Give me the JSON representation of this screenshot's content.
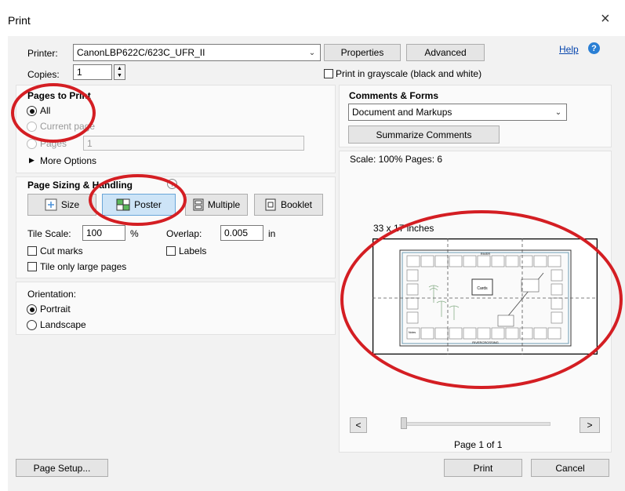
{
  "window": {
    "title": "Print",
    "close_glyph": "×"
  },
  "printer": {
    "label": "Printer:",
    "value": "CanonLBP622C/623C_UFR_II",
    "properties_label": "Properties",
    "advanced_label": "Advanced",
    "help_label": "Help"
  },
  "copies": {
    "label": "Copies:",
    "value": "1"
  },
  "grayscale": {
    "label": "Print in grayscale (black and white)",
    "checked": false
  },
  "pages_to_print": {
    "heading": "Pages to Print",
    "all_label": "All",
    "current_label": "Current page",
    "pages_label": "Pages",
    "pages_value": "1",
    "more_options_label": "More Options",
    "selected": "all"
  },
  "sizing": {
    "heading": "Page Sizing & Handling",
    "size_label": "Size",
    "poster_label": "Poster",
    "multiple_label": "Multiple",
    "booklet_label": "Booklet",
    "selected": "poster",
    "tile_scale_label": "Tile Scale:",
    "tile_scale_value": "100",
    "tile_scale_unit": "%",
    "overlap_label": "Overlap:",
    "overlap_value": "0.005",
    "overlap_unit": "in",
    "cut_marks_label": "Cut marks",
    "labels_label": "Labels",
    "tile_large_label": "Tile only large pages"
  },
  "orientation": {
    "label": "Orientation:",
    "portrait_label": "Portrait",
    "landscape_label": "Landscape",
    "selected": "portrait"
  },
  "comments": {
    "heading": "Comments & Forms",
    "value": "Document and Markups",
    "summarize_label": "Summarize Comments"
  },
  "preview": {
    "scale_text": "Scale: 100% Pages: 6",
    "size_text": "33 x 17 inches",
    "page_text": "Page 1 of 1",
    "prev_glyph": "<",
    "next_glyph": ">",
    "board_top": "RIVER",
    "board_bottom": "RIVERCROSSING",
    "board_center": "Cards",
    "board_corner": "Notes"
  },
  "footer": {
    "page_setup_label": "Page Setup...",
    "print_label": "Print",
    "cancel_label": "Cancel"
  },
  "colors": {
    "annotation": "#d41e23",
    "link": "#0645ad",
    "help_icon": "#2a7fd4"
  }
}
